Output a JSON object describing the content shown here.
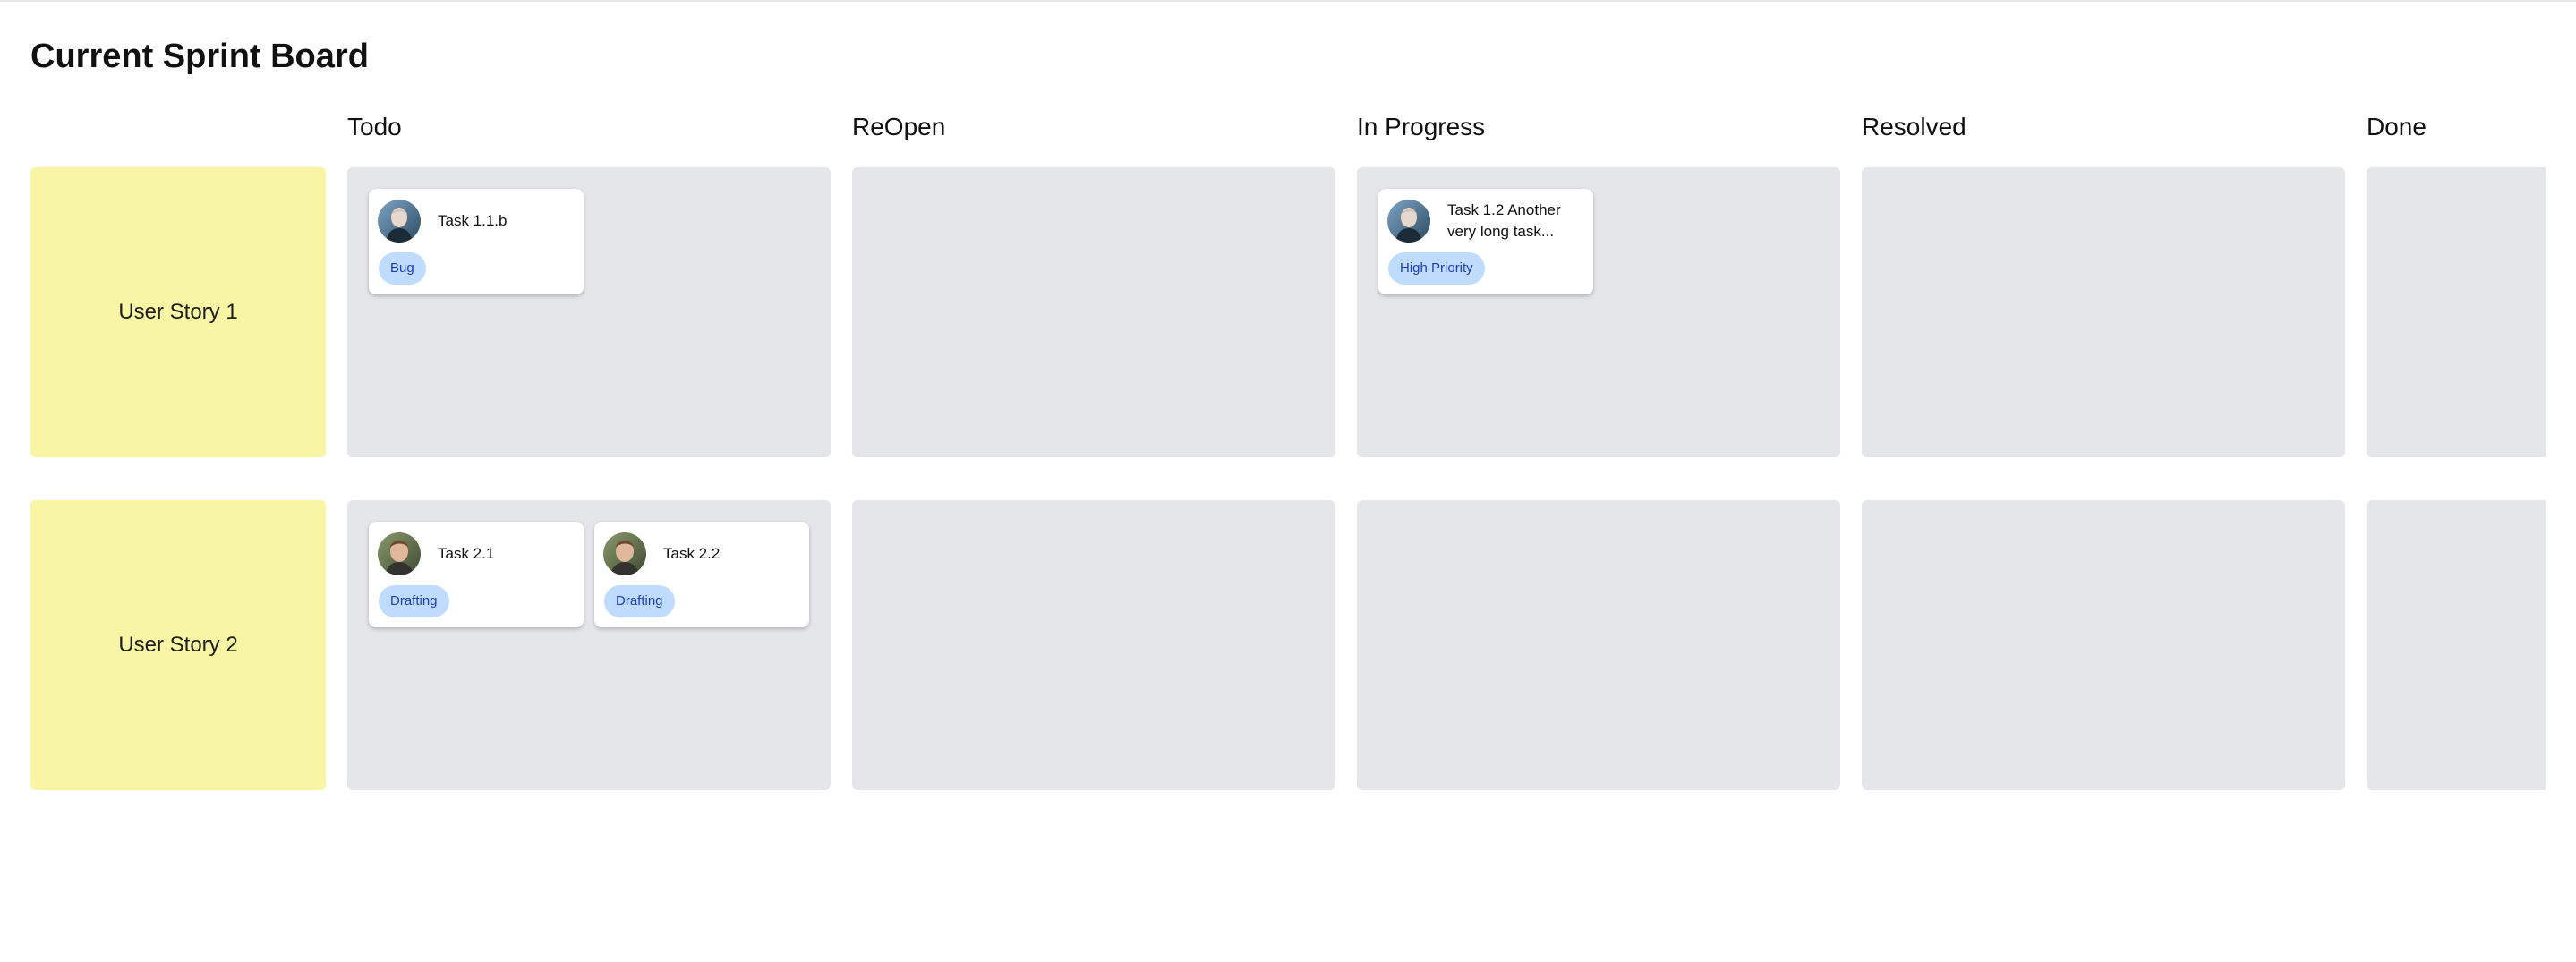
{
  "board": {
    "title": "Current Sprint Board",
    "columns": [
      "Todo",
      "ReOpen",
      "In Progress",
      "Resolved",
      "Done"
    ]
  },
  "stories": [
    {
      "label": "User Story 1",
      "cards": [
        {
          "column": "Todo",
          "title": "Task 1.1.b",
          "tag": "Bug",
          "avatar": "avatar-man-1"
        },
        {
          "column": "In Progress",
          "title": "Task 1.2 Another very long task...",
          "tag": "High Priority",
          "avatar": "avatar-man-1"
        }
      ]
    },
    {
      "label": "User Story 2",
      "cards": [
        {
          "column": "Todo",
          "title": "Task 2.1",
          "tag": "Drafting",
          "avatar": "avatar-man-2"
        },
        {
          "column": "Todo",
          "title": "Task 2.2",
          "tag": "Drafting",
          "avatar": "avatar-man-2"
        }
      ]
    }
  ],
  "colors": {
    "story_bg": "#f8f5a5",
    "cell_bg": "#e5e6e9",
    "tag_bg": "#bfdbfe",
    "tag_text": "#1e40af"
  }
}
